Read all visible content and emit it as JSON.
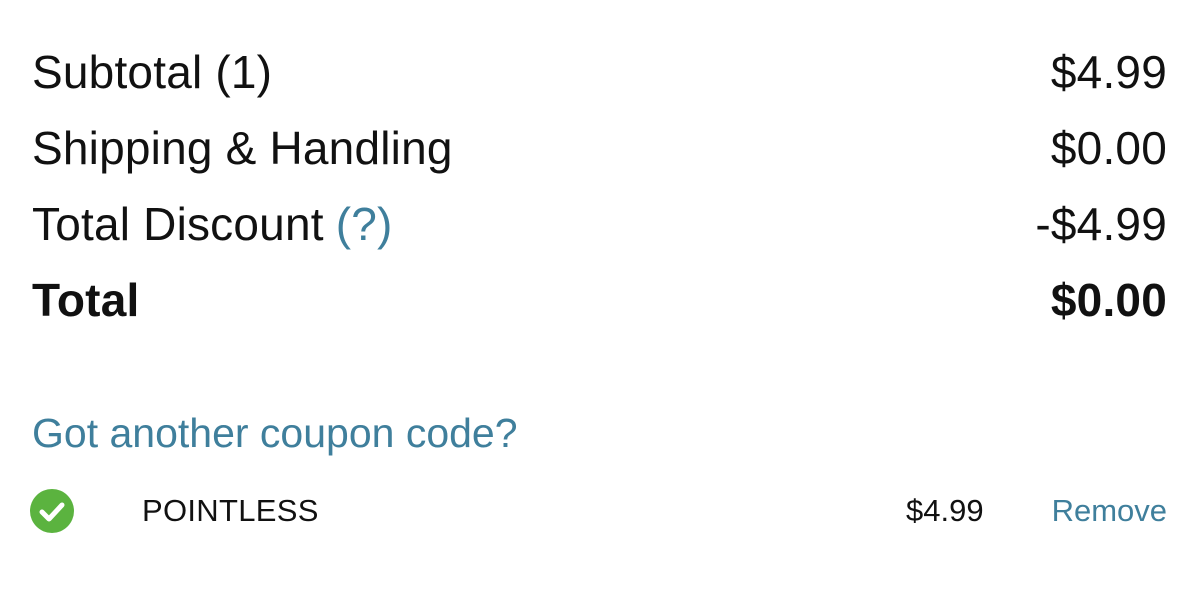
{
  "summary": {
    "subtotal_label": "Subtotal (1)",
    "subtotal_value": "$4.99",
    "shipping_label": "Shipping & Handling",
    "shipping_value": "$0.00",
    "discount_label": "Total Discount",
    "discount_help": "(?)",
    "discount_value": "-$4.99",
    "total_label": "Total",
    "total_value": "$0.00"
  },
  "coupon": {
    "prompt": "Got another coupon code?",
    "applied": {
      "status_icon": "check-circle-icon",
      "code": "POINTLESS",
      "amount": "$4.99",
      "remove_label": "Remove"
    }
  },
  "colors": {
    "link": "#3f7f9c",
    "success": "#5bb33f",
    "text": "#111111"
  }
}
